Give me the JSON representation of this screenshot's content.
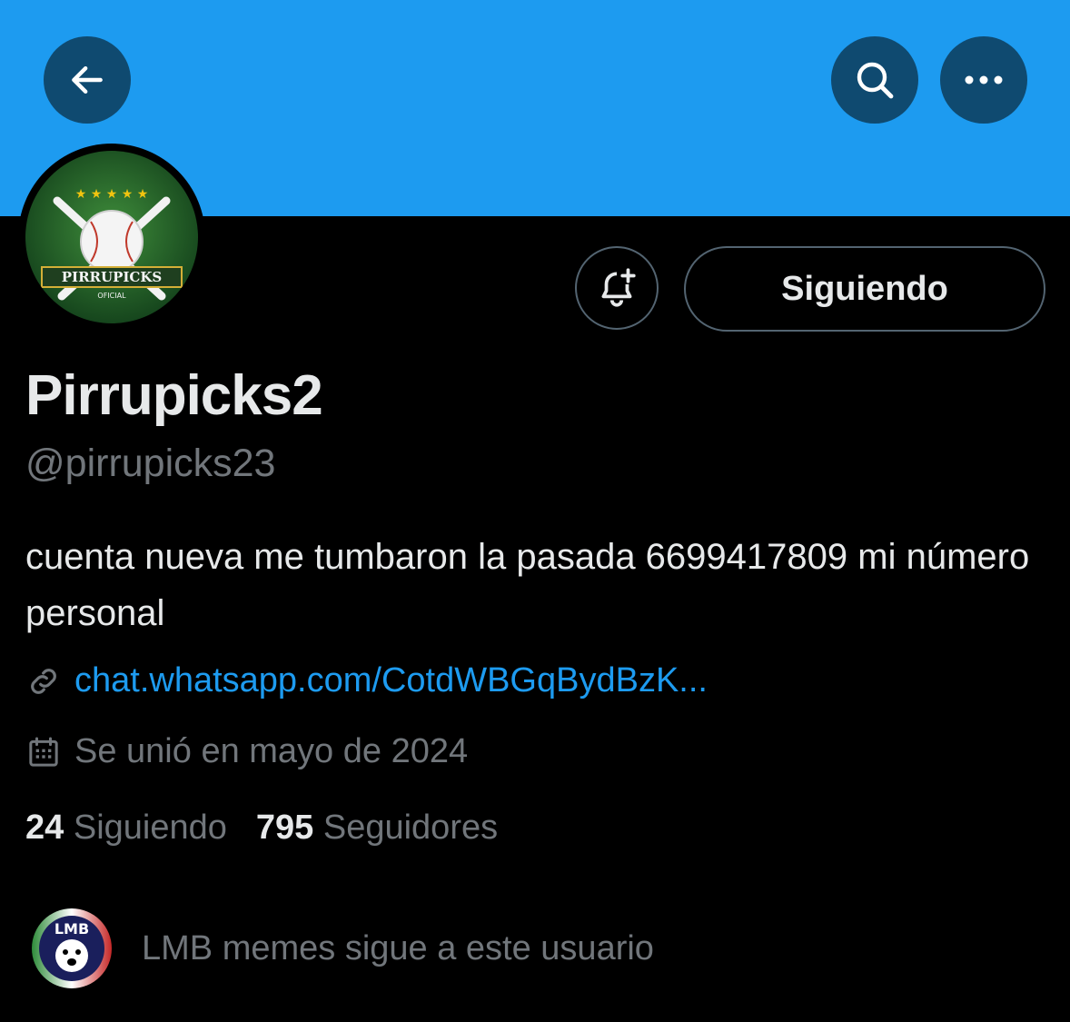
{
  "profile": {
    "display_name": "Pirrupicks2",
    "handle": "@pirrupicks23",
    "bio": "cuenta nueva me tumbaron la pasada 6699417809 mi número personal",
    "link": "chat.whatsapp.com/CotdWBGqBydBzK...",
    "joined": "Se unió en mayo de 2024",
    "following_count": "24",
    "following_label": "Siguiendo",
    "followers_count": "795",
    "followers_label": "Seguidores",
    "followed_by": "LMB memes sigue a este usuario",
    "avatar_text": "PIRRUPICKS",
    "avatar_subtext": "OFICIAL",
    "followed_by_avatar_text": "LMB"
  },
  "actions": {
    "follow_button": "Siguiendo"
  },
  "icons": {
    "back": "arrow-left-icon",
    "search": "search-icon",
    "more": "more-icon",
    "notify": "bell-plus-icon",
    "link": "link-icon",
    "calendar": "calendar-icon"
  },
  "colors": {
    "banner": "#1d9bf0",
    "link": "#1d9bf0",
    "background": "#000000"
  }
}
